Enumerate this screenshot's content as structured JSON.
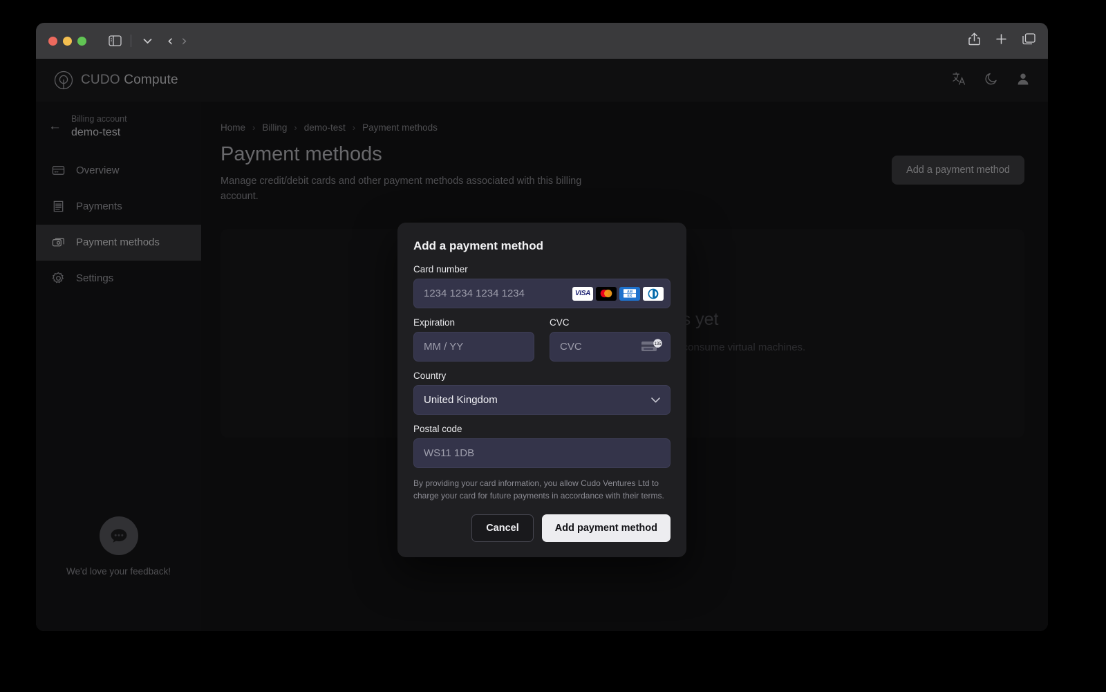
{
  "browser": {
    "toolbar": {
      "sidebar_toggle": "sidebar-toggle",
      "tab_overview_chevron": "chevron-down",
      "back": "back",
      "forward": "forward",
      "share": "share",
      "new_tab": "plus",
      "tab_overview": "tabs"
    }
  },
  "app_header": {
    "brand_primary": "CUDO",
    "brand_secondary": "Compute",
    "icons": [
      "translate-icon",
      "moon-icon",
      "account-icon"
    ]
  },
  "sidebar": {
    "account_label": "Billing account",
    "account_name": "demo-test",
    "back_arrow": "←",
    "items": [
      {
        "label": "Overview",
        "icon": "credit-card-icon",
        "active": false
      },
      {
        "label": "Payments",
        "icon": "receipt-icon",
        "active": false
      },
      {
        "label": "Payment methods",
        "icon": "stacked-cards-icon",
        "active": true
      },
      {
        "label": "Settings",
        "icon": "gear-icon",
        "active": false
      }
    ],
    "feedback_text": "We'd love your feedback!"
  },
  "main": {
    "breadcrumb": [
      "Home",
      "Billing",
      "demo-test",
      "Payment methods"
    ],
    "breadcrumb_separator": "›",
    "title": "Payment methods",
    "subtitle": "Manage credit/debit cards and other payment methods associated with this billing account.",
    "add_button": "Add a payment method",
    "empty_title": "No payment methods yet",
    "empty_subtitle": "A payment method is required to create projects and consume virtual machines."
  },
  "modal": {
    "title": "Add a payment method",
    "card_number": {
      "label": "Card number",
      "placeholder": "1234 1234 1234 1234",
      "value": "",
      "brands": [
        "visa",
        "mastercard",
        "amex",
        "diners"
      ],
      "brand_labels": {
        "visa": "VISA",
        "amex_top": "AM",
        "amex_bottom": "EX"
      }
    },
    "expiration": {
      "label": "Expiration",
      "placeholder": "MM / YY",
      "value": ""
    },
    "cvc": {
      "label": "CVC",
      "placeholder": "CVC",
      "value": "",
      "icon_badge": "135"
    },
    "country": {
      "label": "Country",
      "value": "United Kingdom",
      "chevron": "chevron-down-icon"
    },
    "postal_code": {
      "label": "Postal code",
      "placeholder": "WS11 1DB",
      "value": ""
    },
    "disclaimer": "By providing your card information, you allow Cudo Ventures Ltd to charge your card for future payments in accordance with their terms.",
    "cancel_label": "Cancel",
    "submit_label": "Add payment method"
  },
  "colors": {
    "page_bg": "#141416",
    "sidebar_bg": "#161618",
    "modal_bg": "#1f1f22",
    "input_bg": "#34344a",
    "active_nav": "#38383b",
    "submit_bg": "#ededf0",
    "visa_blue": "#1a1f71",
    "amex_blue": "#1f72cd",
    "mc_red": "#eb001b",
    "mc_orange": "#f79e1b"
  }
}
